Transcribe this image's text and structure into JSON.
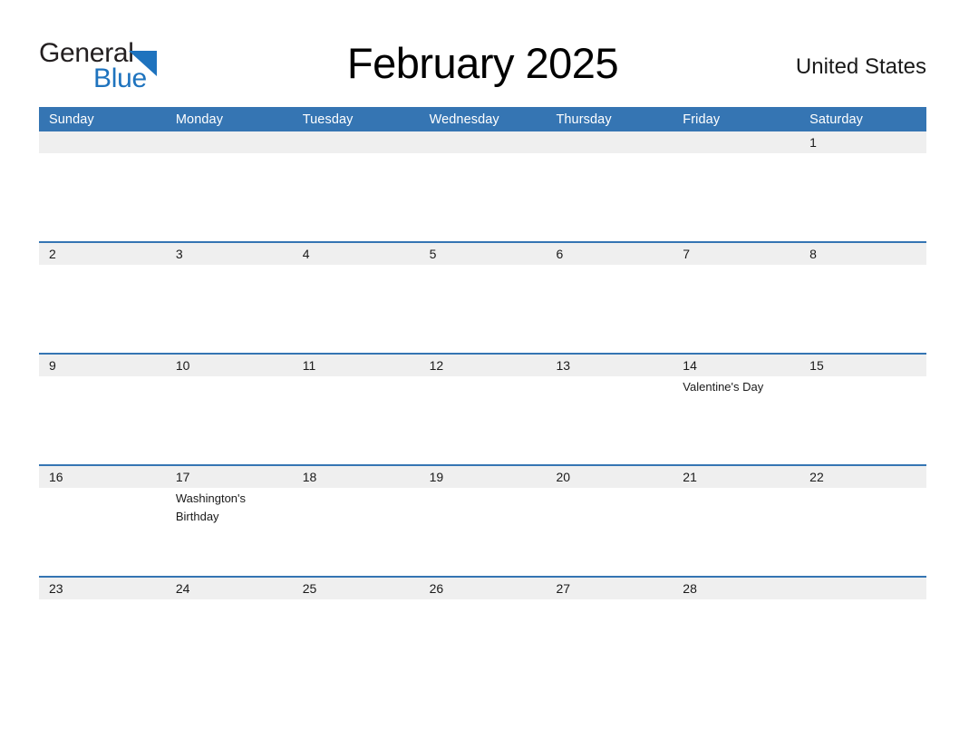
{
  "brand": {
    "name_part1": "General",
    "name_part2": "Blue",
    "triangle_color": "#1e73be",
    "text_color_part1": "#231f20",
    "text_color_part2": "#1e73be"
  },
  "header": {
    "title": "February 2025",
    "country": "United States"
  },
  "theme": {
    "header_blue": "#3575b3",
    "row_divider_blue": "#3575b3",
    "date_strip_gray": "#efefef",
    "page_background": "#ffffff",
    "weekday_text": "#ffffff",
    "body_text": "#1a1a1a"
  },
  "calendar": {
    "month": "February",
    "year": "2025",
    "weekday_headers": [
      "Sunday",
      "Monday",
      "Tuesday",
      "Wednesday",
      "Thursday",
      "Friday",
      "Saturday"
    ],
    "weeks": [
      {
        "dates": [
          "",
          "",
          "",
          "",
          "",
          "",
          "1"
        ],
        "events": [
          "",
          "",
          "",
          "",
          "",
          "",
          ""
        ]
      },
      {
        "dates": [
          "2",
          "3",
          "4",
          "5",
          "6",
          "7",
          "8"
        ],
        "events": [
          "",
          "",
          "",
          "",
          "",
          "",
          ""
        ]
      },
      {
        "dates": [
          "9",
          "10",
          "11",
          "12",
          "13",
          "14",
          "15"
        ],
        "events": [
          "",
          "",
          "",
          "",
          "",
          "Valentine's Day",
          ""
        ]
      },
      {
        "dates": [
          "16",
          "17",
          "18",
          "19",
          "20",
          "21",
          "22"
        ],
        "events": [
          "",
          "Washington's Birthday",
          "",
          "",
          "",
          "",
          ""
        ]
      },
      {
        "dates": [
          "23",
          "24",
          "25",
          "26",
          "27",
          "28",
          ""
        ],
        "events": [
          "",
          "",
          "",
          "",
          "",
          "",
          ""
        ]
      }
    ]
  }
}
